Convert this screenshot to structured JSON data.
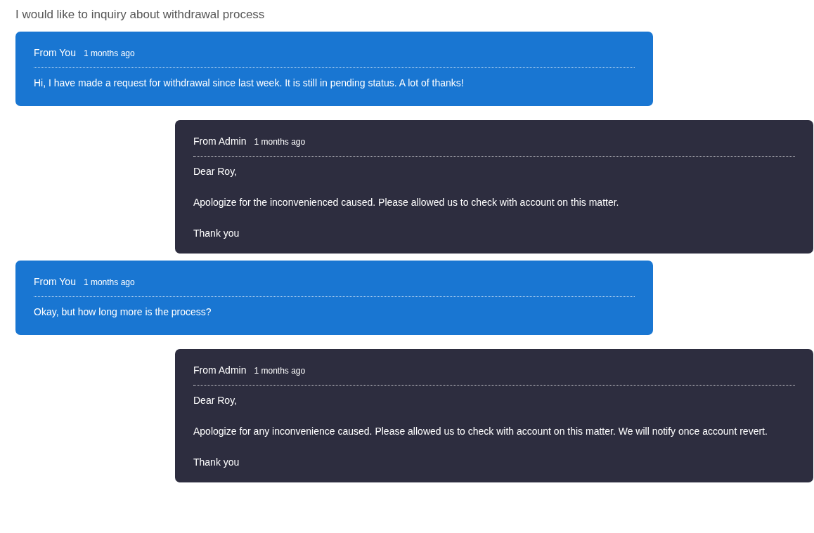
{
  "subject": "I would like to inquiry about withdrawal process",
  "messages": [
    {
      "kind": "you",
      "sender": "From You",
      "time": "1 months ago",
      "paragraphs": [
        "Hi, I have made a request for withdrawal since last week. It is still in pending status. A lot of thanks!"
      ]
    },
    {
      "kind": "admin",
      "sender": "From Admin",
      "time": "1 months ago",
      "paragraphs": [
        "Dear Roy,",
        "Apologize for the inconvenienced caused. Please allowed us to check with account on this matter.",
        "Thank you"
      ]
    },
    {
      "kind": "you",
      "sender": "From You",
      "time": "1 months ago",
      "paragraphs": [
        "Okay, but how long more is the process?"
      ]
    },
    {
      "kind": "admin",
      "sender": "From Admin",
      "time": "1 months ago",
      "paragraphs": [
        "Dear Roy,",
        "Apologize for any inconvenience caused. Please allowed us to check with account on this matter. We will notify once account revert.",
        "Thank you"
      ]
    }
  ]
}
